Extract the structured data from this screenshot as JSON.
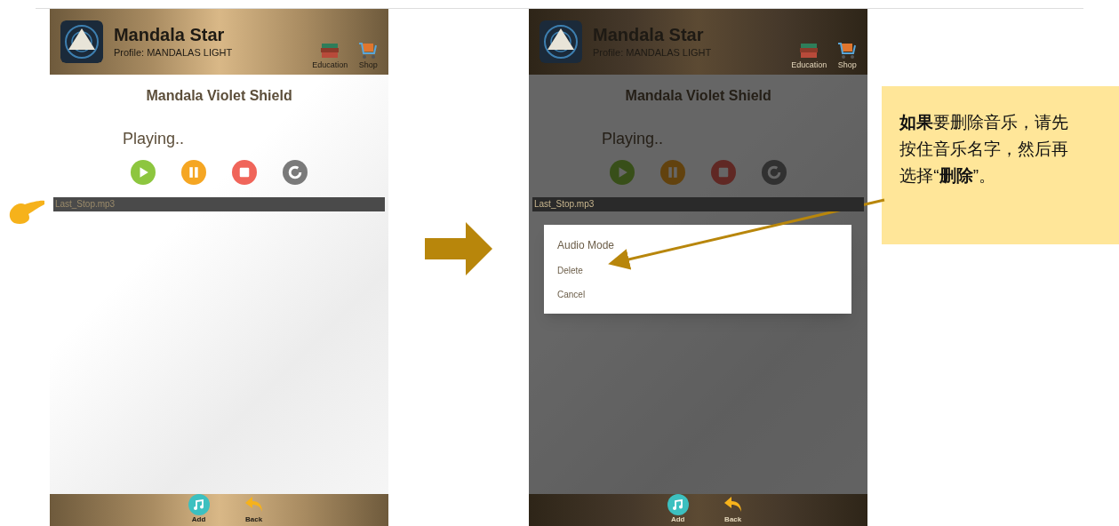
{
  "screens": [
    {
      "dimmed": false,
      "header": {
        "app_name": "Mandala Star",
        "profile": "Profile:  MANDALAS LIGHT",
        "actions": [
          "Education",
          "Shop"
        ]
      },
      "track_title": "Mandala Violet Shield",
      "status": "Playing..",
      "file": {
        "name": "Last_Stop.mp3"
      },
      "footer": [
        "Add",
        "Back"
      ]
    },
    {
      "dimmed": true,
      "header": {
        "app_name": "Mandala Star",
        "profile": "Profile:  MANDALAS LIGHT",
        "actions": [
          "Education",
          "Shop"
        ]
      },
      "track_title": "Mandala Violet Shield",
      "status": "Playing..",
      "file": {
        "name": "Last_Stop.mp3"
      },
      "footer": [
        "Add",
        "Back"
      ],
      "dialog": {
        "items": [
          "Audio Mode",
          "Delete",
          "Cancel"
        ]
      }
    }
  ],
  "callout": {
    "text": "**如果**要删除音乐，请先按住音乐名字，然后再选择“**删除**”。"
  }
}
